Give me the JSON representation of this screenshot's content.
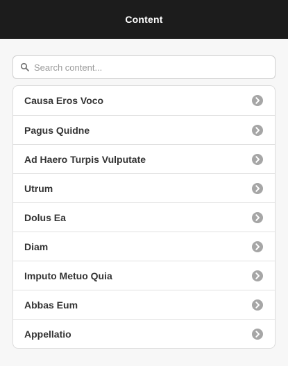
{
  "header": {
    "title": "Content"
  },
  "search": {
    "placeholder": "Search content..."
  },
  "list": {
    "items": [
      {
        "label": "Causa Eros Voco"
      },
      {
        "label": "Pagus Quidne"
      },
      {
        "label": "Ad Haero Turpis Vulputate"
      },
      {
        "label": "Utrum"
      },
      {
        "label": "Dolus Ea"
      },
      {
        "label": "Diam"
      },
      {
        "label": "Imputo Metuo Quia"
      },
      {
        "label": "Abbas Eum"
      },
      {
        "label": "Appellatio"
      }
    ]
  },
  "colors": {
    "header_bg": "#1c1c1c",
    "chevron_bg": "#a6a6a6"
  },
  "icons": {
    "search": "search-icon",
    "item_arrow": "chevron-right-icon"
  }
}
